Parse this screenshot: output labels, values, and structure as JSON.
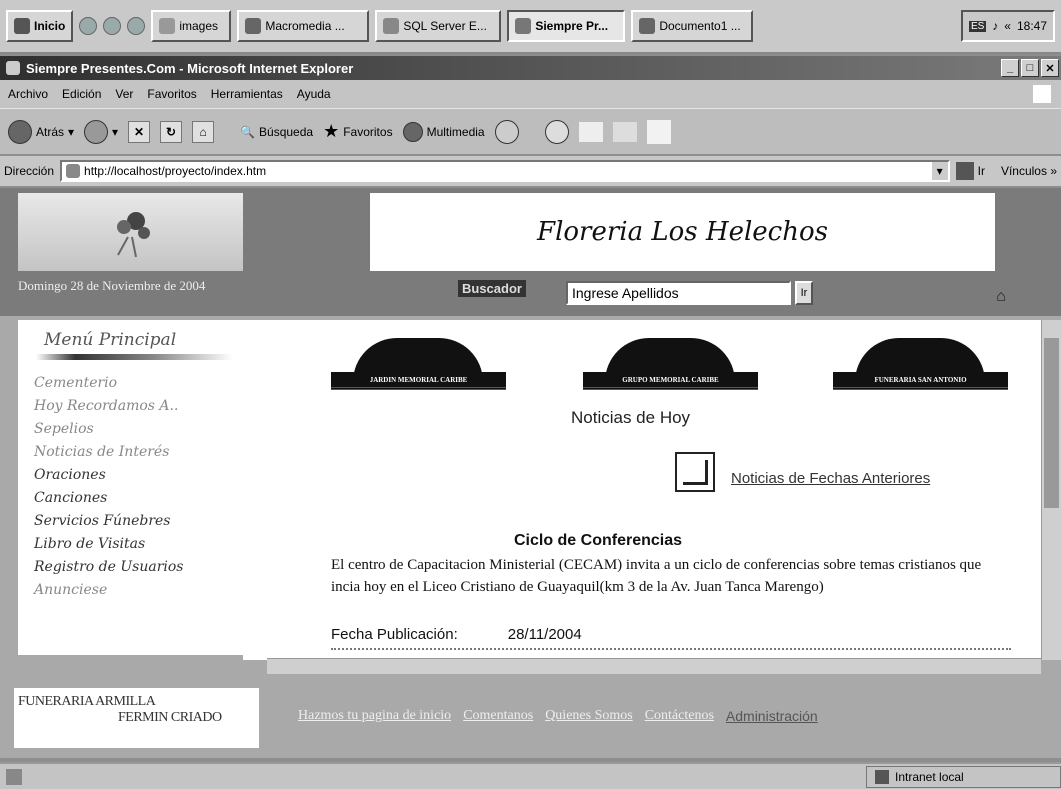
{
  "taskbar": {
    "start_label": "Inicio",
    "tasks": [
      "images",
      "Macromedia ...",
      "SQL Server E...",
      "Siempre Pr...",
      "Documento1 ..."
    ],
    "clock": "18:47",
    "lang": "ES"
  },
  "window": {
    "title": "Siempre Presentes.Com - Microsoft Internet Explorer"
  },
  "menubar": [
    "Archivo",
    "Edición",
    "Ver",
    "Favoritos",
    "Herramientas",
    "Ayuda"
  ],
  "toolbar": {
    "back": "Atrás",
    "search": "Búsqueda",
    "favorites": "Favoritos",
    "multimedia": "Multimedia"
  },
  "address": {
    "label": "Dirección",
    "url": "http://localhost/proyecto/index.htm",
    "go": "Ir",
    "links": "Vínculos"
  },
  "header": {
    "banner": "Floreria Los Helechos",
    "date": "Domingo 28 de Noviembre de 2004",
    "search_label": "Buscador",
    "search_value": "Ingrese Apellidos",
    "go_button": "Ir"
  },
  "left_menu": {
    "title": "Menú Principal",
    "items": [
      "Cementerio",
      "Hoy Recordamos A..",
      "Sepelios",
      "Noticias de Interés",
      "Oraciones",
      "Canciones",
      "Servicios Fúnebres",
      "Libro de Visitas",
      "Registro de Usuarios",
      "Anunciese"
    ]
  },
  "logos": [
    "JARDIN MEMORIAL CARIBE",
    "GRUPO MEMORIAL CARIBE",
    "FUNERARIA SAN ANTONIO"
  ],
  "news": {
    "today_title": "Noticias de Hoy",
    "older_link": "Noticias de Fechas Anteriores",
    "article_title": "Ciclo de Conferencias",
    "article_body": "El centro de Capacitacion Ministerial (CECAM) invita a un ciclo de conferencias sobre temas cristianos que incia hoy en el Liceo Cristiano de Guayaquil(km 3 de la Av. Juan Tanca Marengo)",
    "date_label": "Fecha Publicación:",
    "date_value": "28/11/2004"
  },
  "footer": {
    "box_line1": "FUNERARIA ARMILLA",
    "box_line2": "FERMIN CRIADO",
    "links": [
      "Hazmos tu pagina de inicio",
      "Comentanos",
      "Quienes Somos",
      "Contáctenos",
      "Administración"
    ]
  },
  "status": {
    "zone": "Intranet local"
  }
}
